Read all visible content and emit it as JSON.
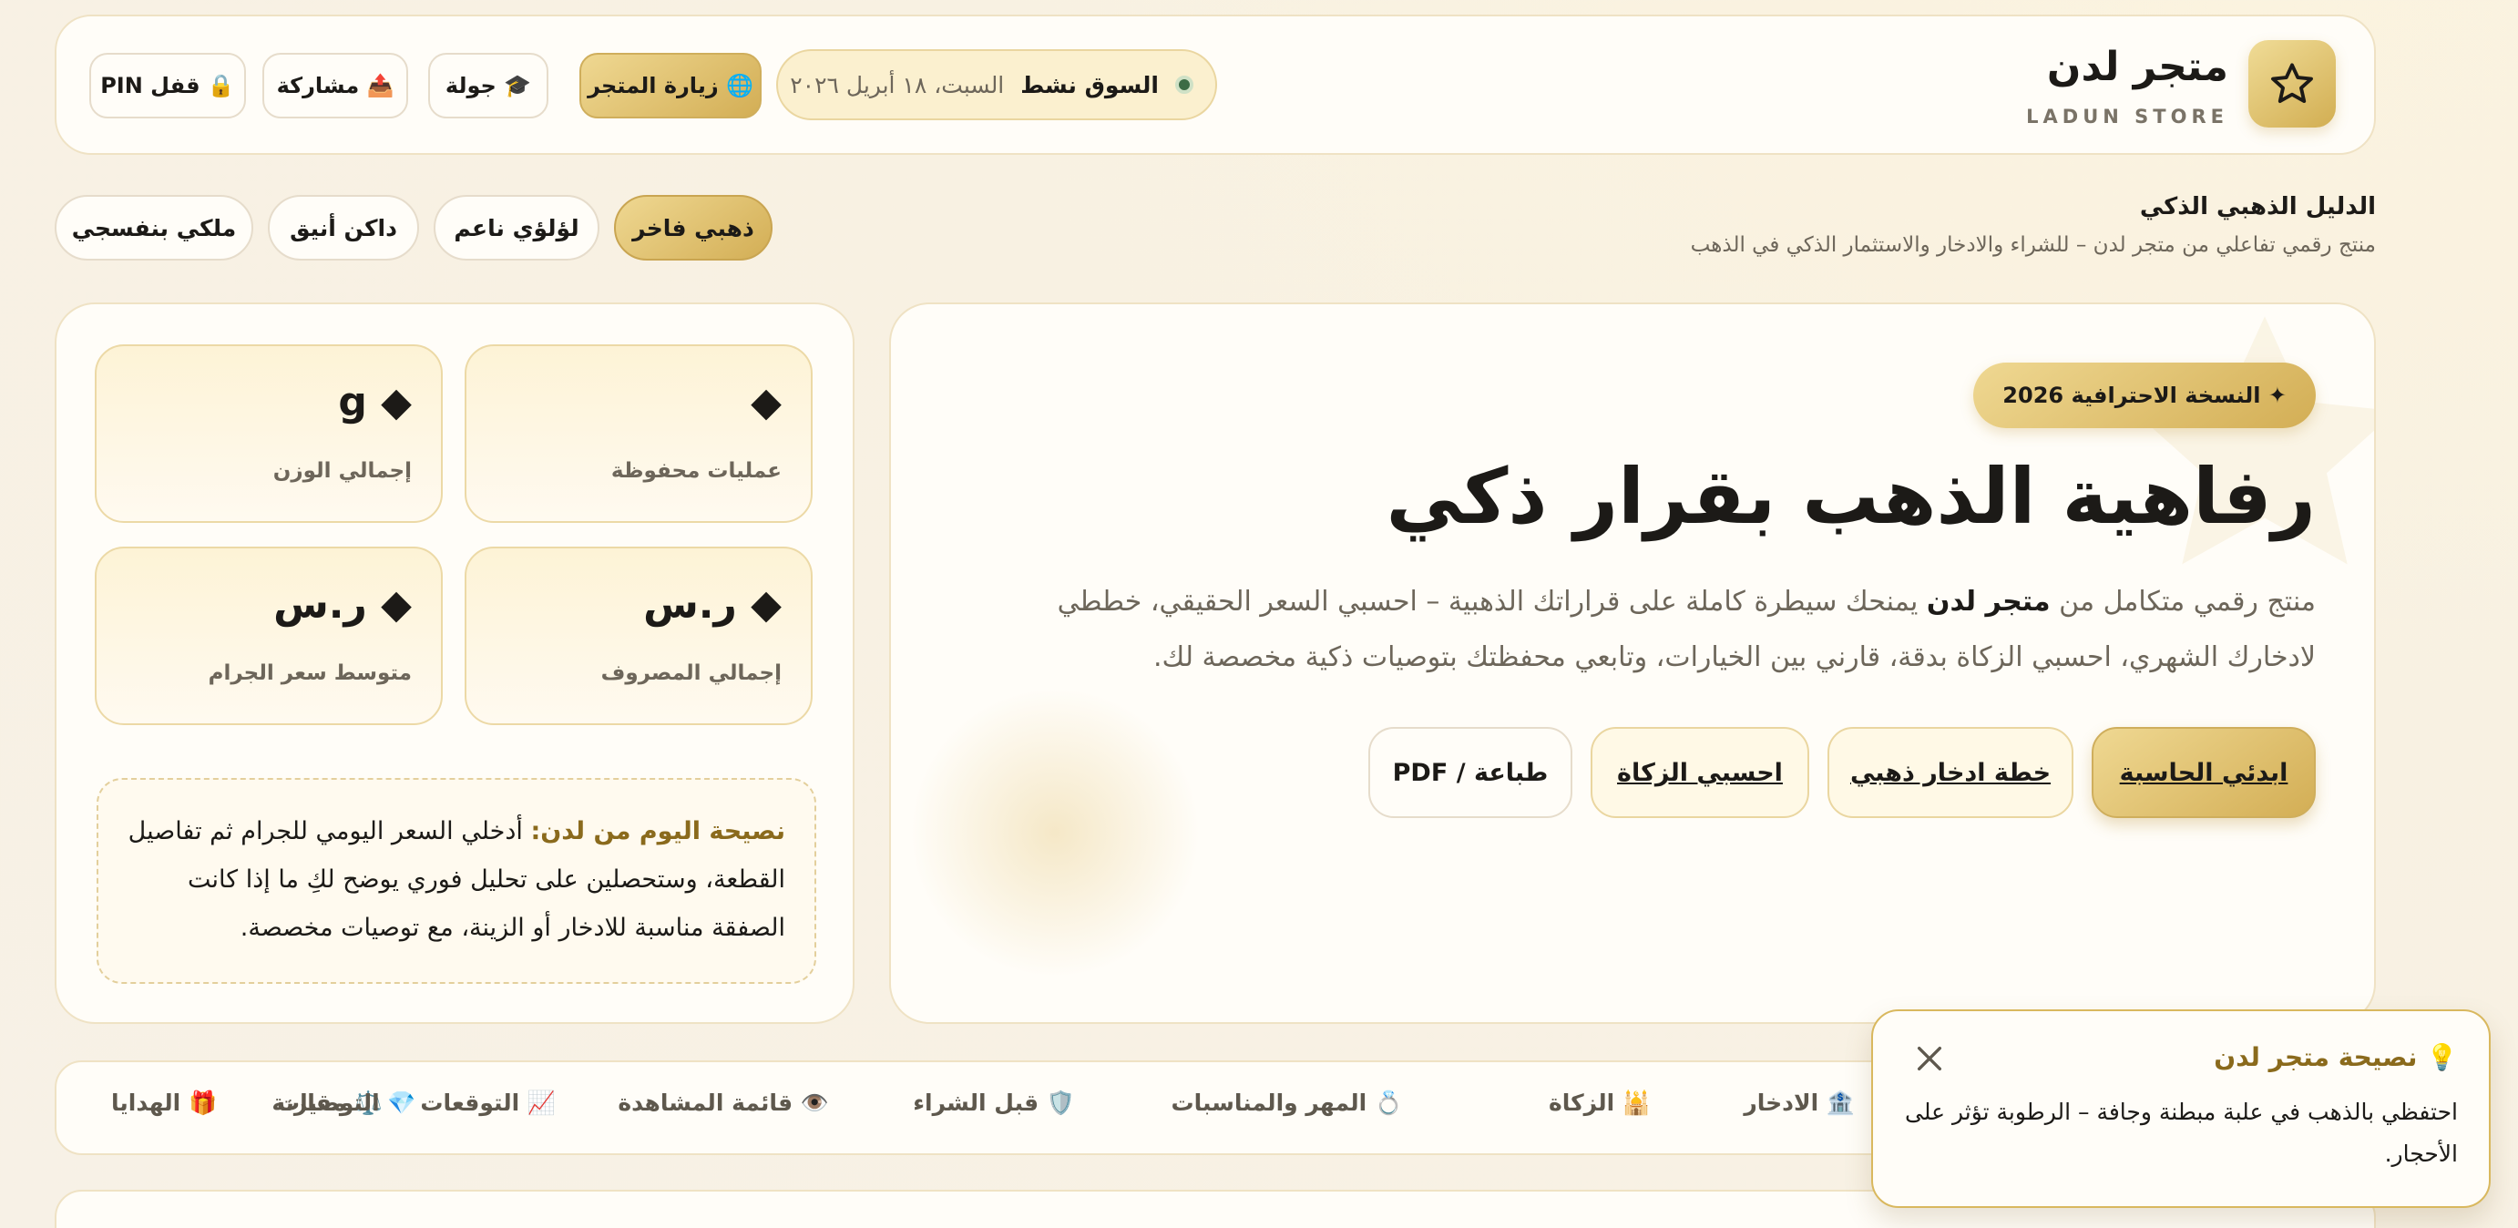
{
  "header": {
    "brand_name": "متجر لدن",
    "brand_sub": "LADUN STORE",
    "market_status": "السوق نشط",
    "market_date": "السبت، ١٨ أبريل ٢٠٢٦",
    "buttons": {
      "visit_store": "🌐 زيارة المتجر",
      "tour": "🎓 جولة",
      "share": "📤 مشاركة",
      "pin_lock": "🔒 قفل PIN"
    }
  },
  "guide": {
    "title": "الدليل الذهبي الذكي",
    "subtitle": "منتج رقمي تفاعلي من متجر لدن – للشراء والادخار والاستثمار الذكي في الذهب"
  },
  "themes": [
    "ذهبي فاخر",
    "لؤلؤي ناعم",
    "داكن أنيق",
    "ملكي بنفسجي"
  ],
  "hero": {
    "badge": "✦ النسخة الاحترافية 2026",
    "title": "رفاهية الذهب بقرار ذكي",
    "desc_pre": "منتج رقمي متكامل من ",
    "desc_brand": "متجر لدن",
    "desc_post": " يمنحك سيطرة كاملة على قراراتك الذهبية – احسبي السعر الحقيقي، خططي لادخارك الشهري، احسبي الزكاة بدقة، قارني بين الخيارات، وتابعي محفظتك بتوصيات ذكية مخصصة لك.",
    "buttons": {
      "start": "ابدئي الحاسبة",
      "savings": "خطة ادخار ذهبي",
      "zakat": "احسبي الزكاة",
      "print": "طباعة / PDF"
    }
  },
  "stats": {
    "saved_ops": {
      "value": "◆",
      "label": "عمليات محفوظة"
    },
    "total_weight": {
      "value": "◆ g",
      "label": "إجمالي الوزن"
    },
    "total_spent": {
      "value": "◆ ر.س",
      "label": "إجمالي المصروف"
    },
    "avg_price": {
      "value": "◆ ر.س",
      "label": "متوسط سعر الجرام"
    }
  },
  "tip": {
    "label": "نصيحة اليوم من لدن:",
    "text": " أدخلي السعر اليومي للجرام ثم تفاصيل القطعة، وستحصلين على تحليل فوري يوضح لكِ ما إذا كانت الصفقة مناسبة للادخار أو الزينة، مع توصيات مخصصة."
  },
  "nav": [
    "🏦 الادخار",
    "🕌 الزكاة",
    "💍 المهر والمناسبات",
    "🛡️ قبل الشراء",
    "👁️ قائمة المشاهدة",
    "📈 التوقعات",
    "⚖️ مقارنة",
    "💎 التوصيات",
    "🎁 الهدايا"
  ],
  "toast": {
    "title": "💡 نصيحة متجر لدن",
    "body": "احتفظي بالذهب في علبة مبطنة وجافة – الرطوبة تؤثر على الأحجار."
  },
  "icons": {
    "logo": "star-icon",
    "market": "status-dot-icon",
    "close": "close-icon"
  },
  "colors": {
    "gold_light": "#efd892",
    "gold_dark": "#d3ae55",
    "accent_text": "#8a6a1c",
    "status_green": "#3c6b45"
  }
}
